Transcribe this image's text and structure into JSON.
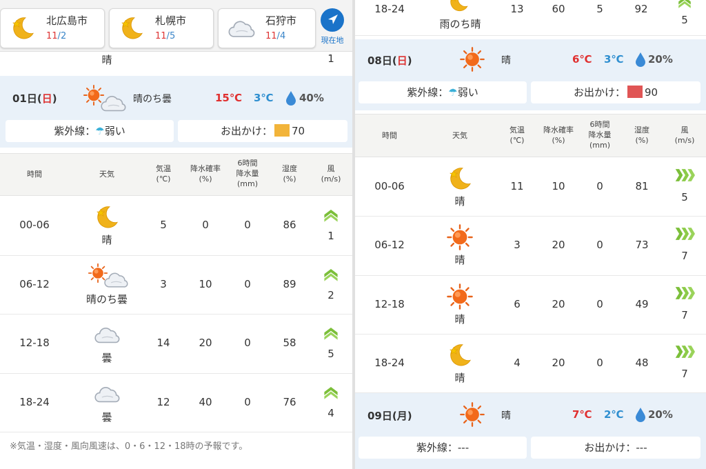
{
  "left": {
    "locations": [
      {
        "name": "北広島市",
        "month": "11",
        "day": "2",
        "icon": "moon-icon"
      },
      {
        "name": "札幌市",
        "month": "11",
        "day": "5",
        "icon": "moon-icon"
      },
      {
        "name": "石狩市",
        "month": "11",
        "day": "4",
        "icon": "cloud-icon"
      }
    ],
    "gps_label": "現在地",
    "partial_row": {
      "weather": "晴",
      "wind": "1"
    },
    "day": {
      "date": "01日(",
      "dow": "日",
      "close": ")",
      "weather": "晴のち曇",
      "high": "15℃",
      "low": "3℃",
      "rain": "40%",
      "uv_label": "紫外線：",
      "uv_value": "弱い",
      "outing_label": "お出かけ：",
      "outing_value": "70"
    },
    "headers": [
      "時間",
      "天気",
      "気温\n(℃)",
      "降水確率\n(%)",
      "6時間\n降水量\n(mm)",
      "湿度\n(%)",
      "風\n(m/s)"
    ],
    "rows": [
      {
        "time": "00-06",
        "icon": "moon-icon",
        "weather": "晴",
        "temp": "5",
        "pop": "0",
        "precip": "0",
        "humidity": "86",
        "wind": "1"
      },
      {
        "time": "06-12",
        "icon": "sun-then-cloud-icon",
        "weather": "晴のち曇",
        "temp": "3",
        "pop": "10",
        "precip": "0",
        "humidity": "89",
        "wind": "2"
      },
      {
        "time": "12-18",
        "icon": "cloud-icon",
        "weather": "曇",
        "temp": "14",
        "pop": "20",
        "precip": "0",
        "humidity": "58",
        "wind": "5"
      },
      {
        "time": "18-24",
        "icon": "cloud-icon",
        "weather": "曇",
        "temp": "12",
        "pop": "40",
        "precip": "0",
        "humidity": "76",
        "wind": "4"
      }
    ],
    "note": "※気温・湿度・風向風速は、0・6・12・18時の予報です。"
  },
  "right": {
    "partial_row": {
      "time": "18-24",
      "weather": "雨のち晴",
      "temp": "13",
      "pop": "60",
      "precip": "5",
      "humidity": "92",
      "wind": "5"
    },
    "day8": {
      "date": "08日(",
      "dow": "日",
      "close": ")",
      "weather": "晴",
      "high": "6℃",
      "low": "3℃",
      "rain": "20%",
      "uv_label": "紫外線：",
      "uv_value": "弱い",
      "outing_label": "お出かけ：",
      "outing_value": "90"
    },
    "headers": [
      "時間",
      "天気",
      "気温\n(℃)",
      "降水確率\n(%)",
      "6時間\n降水量\n(mm)",
      "湿度\n(%)",
      "風\n(m/s)"
    ],
    "rows": [
      {
        "time": "00-06",
        "icon": "moon-icon",
        "weather": "晴",
        "temp": "11",
        "pop": "10",
        "precip": "0",
        "humidity": "81",
        "wind": "5"
      },
      {
        "time": "06-12",
        "icon": "sun-icon",
        "weather": "晴",
        "temp": "3",
        "pop": "20",
        "precip": "0",
        "humidity": "73",
        "wind": "7"
      },
      {
        "time": "12-18",
        "icon": "sun-icon",
        "weather": "晴",
        "temp": "6",
        "pop": "20",
        "precip": "0",
        "humidity": "49",
        "wind": "7"
      },
      {
        "time": "18-24",
        "icon": "moon-icon",
        "weather": "晴",
        "temp": "4",
        "pop": "20",
        "precip": "0",
        "humidity": "48",
        "wind": "7"
      }
    ],
    "day9": {
      "date": "09日(月)",
      "weather": "晴",
      "high": "7℃",
      "low": "2℃",
      "rain": "20%",
      "uv_label": "紫外線：",
      "uv_value": "---",
      "outing_label": "お出かけ：",
      "outing_value": "---"
    }
  },
  "colors": {
    "high": "#e03030",
    "low": "#2f8fd0",
    "sunday": "#d33",
    "wind": "#7cbf3a",
    "header_bg": "#e9f1f9"
  }
}
